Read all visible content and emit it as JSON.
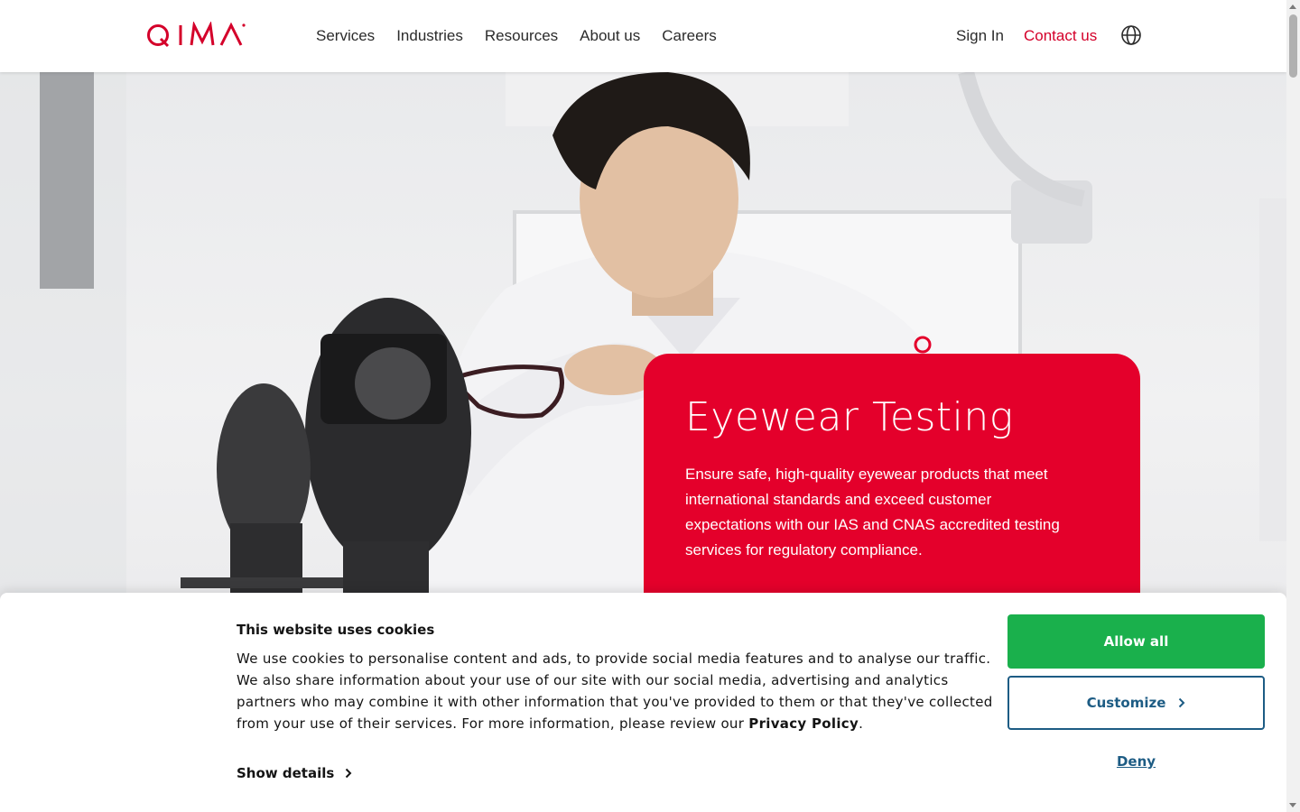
{
  "header": {
    "logo_text": "QIMA",
    "nav": [
      "Services",
      "Industries",
      "Resources",
      "About us",
      "Careers"
    ],
    "sign_in": "Sign In",
    "contact": "Contact us",
    "brand_color": "#d4002a"
  },
  "hero": {
    "title": "Eyewear Testing",
    "description": "Ensure safe, high-quality eyewear products that meet international standards and exceed customer expectations with our IAS and CNAS accredited testing services for regulatory compliance.",
    "card_color": "#e4002b"
  },
  "cookie": {
    "title": "This website uses cookies",
    "text": "We use cookies to personalise content and ads, to provide social media features and to analyse our traffic. We also share information about your use of our site with our social media, advertising and analytics partners who may combine it with other information that you've provided to them or that they've collected from your use of their services. For more information, please review our",
    "privacy_link": "Privacy Policy",
    "text_end": ".",
    "show_details": "Show details",
    "allow_all": "Allow all",
    "customize": "Customize",
    "deny": "Deny",
    "allow_color": "#1ab04c",
    "link_color": "#1d5c84"
  }
}
